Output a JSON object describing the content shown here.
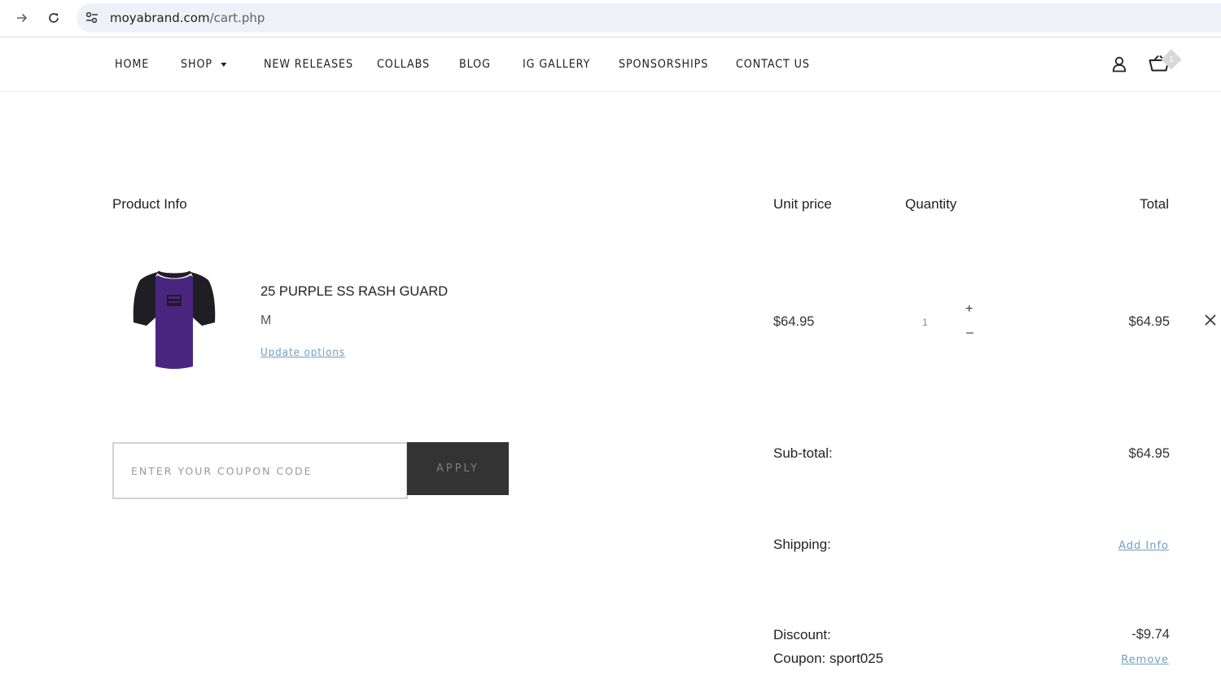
{
  "browser": {
    "url_host": "moyabrand.com",
    "url_path": "/cart.php",
    "forward_icon": "arrow-right",
    "reload_icon": "reload",
    "site_settings_icon": "tune"
  },
  "nav": {
    "items": [
      {
        "label": "HOME"
      },
      {
        "label": "SHOP",
        "has_dropdown": true
      },
      {
        "label": "NEW RELEASES"
      },
      {
        "label": "COLLABS"
      },
      {
        "label": "BLOG"
      },
      {
        "label": "IG GALLERY"
      },
      {
        "label": "SPONSORSHIPS"
      },
      {
        "label": "CONTACT US"
      }
    ],
    "user_icon": "user",
    "cart_icon": "basket",
    "cart_count": "1"
  },
  "cart": {
    "headers": {
      "product": "Product Info",
      "unit_price": "Unit price",
      "quantity": "Quantity",
      "total": "Total"
    },
    "items": [
      {
        "name": "25 PURPLE SS RASH GUARD",
        "variant": "M",
        "update_label": "Update options",
        "unit_price": "$64.95",
        "quantity": "1",
        "plus": "+",
        "minus": "–",
        "total": "$64.95",
        "image_colors": {
          "body": "#4a2580",
          "sleeves": "#1e1e24"
        }
      }
    ]
  },
  "coupon": {
    "placeholder": "ENTER YOUR COUPON CODE",
    "apply_label": "APPLY"
  },
  "summary": {
    "subtotal_label": "Sub-total:",
    "subtotal_value": "$64.95",
    "shipping_label": "Shipping:",
    "shipping_link": "Add Info",
    "discount_label": "Discount:",
    "discount_value": "-$9.74",
    "coupon_label": "Coupon: sport025",
    "coupon_remove": "Remove"
  },
  "colors": {
    "link": "#6f9fbf",
    "apply_bg": "#333333",
    "address_bg": "#eef1f8"
  }
}
